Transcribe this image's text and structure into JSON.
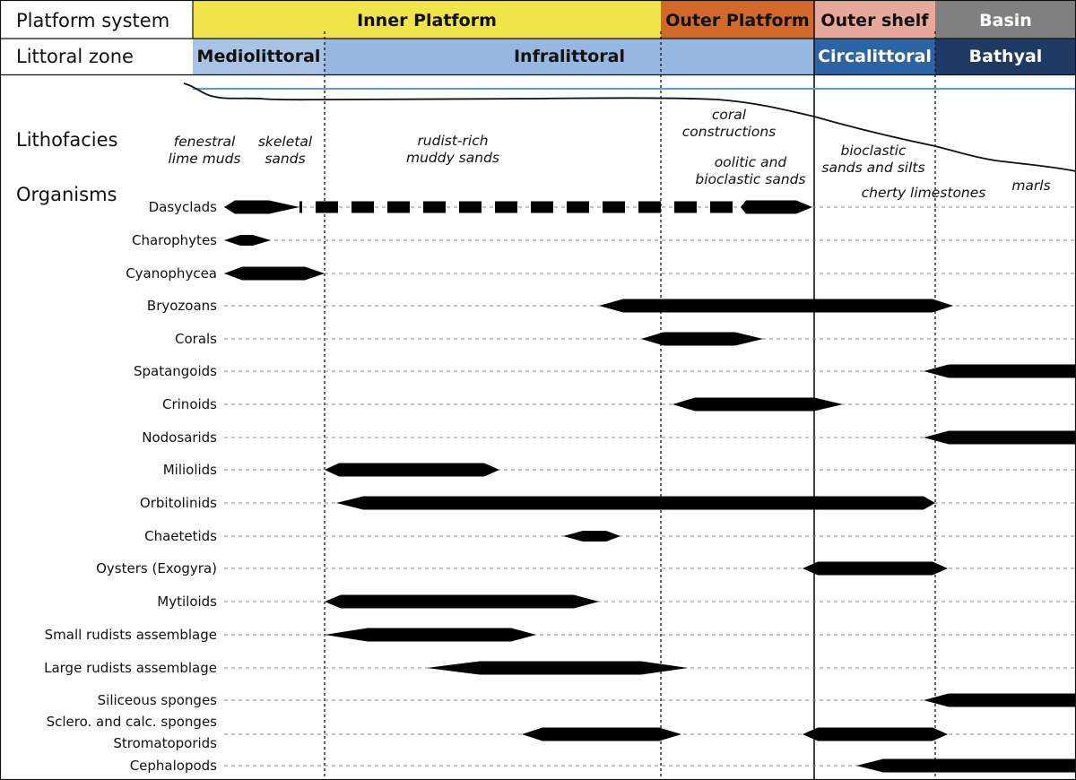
{
  "header": {
    "platform_label": "Platform system",
    "littoral_label": "Littoral zone",
    "lithofacies_label": "Lithofacies",
    "organisms_label": "Organisms"
  },
  "platform_zones": [
    {
      "label": "Inner Platform",
      "color": "#f1e34a",
      "text_color": "#111111"
    },
    {
      "label": "Outer Platform",
      "color": "#d2692b",
      "text_color": "#111111"
    },
    {
      "label": "Outer shelf",
      "color": "#e7a89a",
      "text_color": "#111111"
    },
    {
      "label": "Basin",
      "color": "#808080",
      "text_color": "#ffffff"
    }
  ],
  "littoral_zones": [
    {
      "label": "Mediolittoral",
      "color": "#a9c3e4",
      "text_color": "#111111"
    },
    {
      "label": "Infralittoral",
      "color": "#96b8e0",
      "text_color": "#111111"
    },
    {
      "label": "Circalittoral",
      "color": "#2d64a5",
      "text_color": "#ffffff"
    },
    {
      "label": "Bathyal",
      "color": "#1f3b63",
      "text_color": "#ffffff"
    }
  ],
  "lithofacies": [
    {
      "lines": [
        "fenestral",
        "lime muds"
      ]
    },
    {
      "lines": [
        "skeletal",
        "sands"
      ]
    },
    {
      "lines": [
        "rudist-rich",
        "muddy sands"
      ]
    },
    {
      "lines": [
        "coral",
        "constructions"
      ]
    },
    {
      "lines": [
        "oolitic and",
        "bioclastic sands"
      ]
    },
    {
      "lines": [
        "bioclastic",
        "sands and silts"
      ]
    },
    {
      "lines": [
        "cherty limestones"
      ]
    },
    {
      "lines": [
        "marls"
      ]
    }
  ],
  "organisms": [
    {
      "name": "Dasyclads"
    },
    {
      "name": "Charophytes"
    },
    {
      "name": "Cyanophycea"
    },
    {
      "name": "Bryozoans"
    },
    {
      "name": "Corals"
    },
    {
      "name": "Spatangoids"
    },
    {
      "name": "Crinoids"
    },
    {
      "name": "Nodosarids"
    },
    {
      "name": "Miliolids"
    },
    {
      "name": "Orbitolinids"
    },
    {
      "name": "Chaetetids"
    },
    {
      "name": "Oysters (Exogyra)"
    },
    {
      "name": "Mytiloids"
    },
    {
      "name": "Small rudists assemblage"
    },
    {
      "name": "Large rudists assemblage"
    },
    {
      "name": "Siliceous sponges"
    },
    {
      "name": "Sclero. and calc. sponges"
    },
    {
      "name": "Stromatoporids"
    },
    {
      "name": "Cephalopods"
    }
  ],
  "colors": {
    "bar": "#000000",
    "sea_level": "#5b9bd5",
    "grid": "#888888"
  }
}
